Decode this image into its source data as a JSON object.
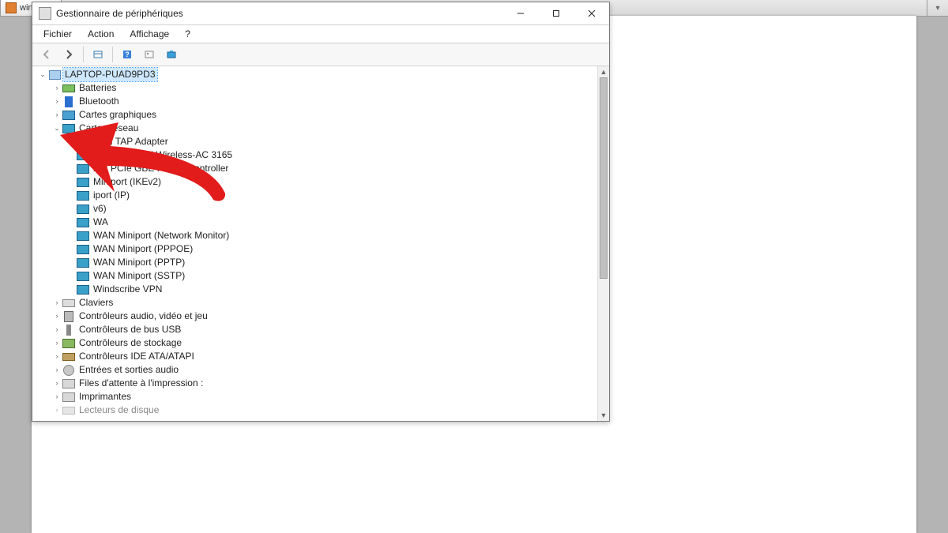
{
  "taskbar": {
    "tab_label": "windows"
  },
  "window": {
    "title": "Gestionnaire de périphériques"
  },
  "menubar": {
    "fichier": "Fichier",
    "action": "Action",
    "affichage": "Affichage",
    "aide": "?"
  },
  "tree": {
    "root": "LAPTOP-PUAD9PD3",
    "batteries": "Batteries",
    "bluetooth": "Bluetooth",
    "graphics": "Cartes graphiques",
    "network": "Cartes réseau",
    "net_children": [
      "VPN TAP Adapter",
      "(R) Dual Band Wireless-AC 3165",
      "ltek PCIe GBE Family Controller",
      "Miniport (IKEv2)",
      "iport (IP)",
      "v6)",
      "WA",
      "WAN Miniport (Network Monitor)",
      "WAN Miniport (PPPOE)",
      "WAN Miniport (PPTP)",
      "WAN Miniport (SSTP)",
      "Windscribe VPN"
    ],
    "keyboards": "Claviers",
    "audio_ctrl": "Contrôleurs audio, vidéo et jeu",
    "usb_ctrl": "Contrôleurs de bus USB",
    "storage_ctrl": "Contrôleurs de stockage",
    "ide_ctrl": "Contrôleurs IDE ATA/ATAPI",
    "io_audio": "Entrées et sorties audio",
    "print_queue": "Files d'attente à l'impression :",
    "printers": "Imprimantes",
    "disks": "Lecteurs de disque"
  }
}
